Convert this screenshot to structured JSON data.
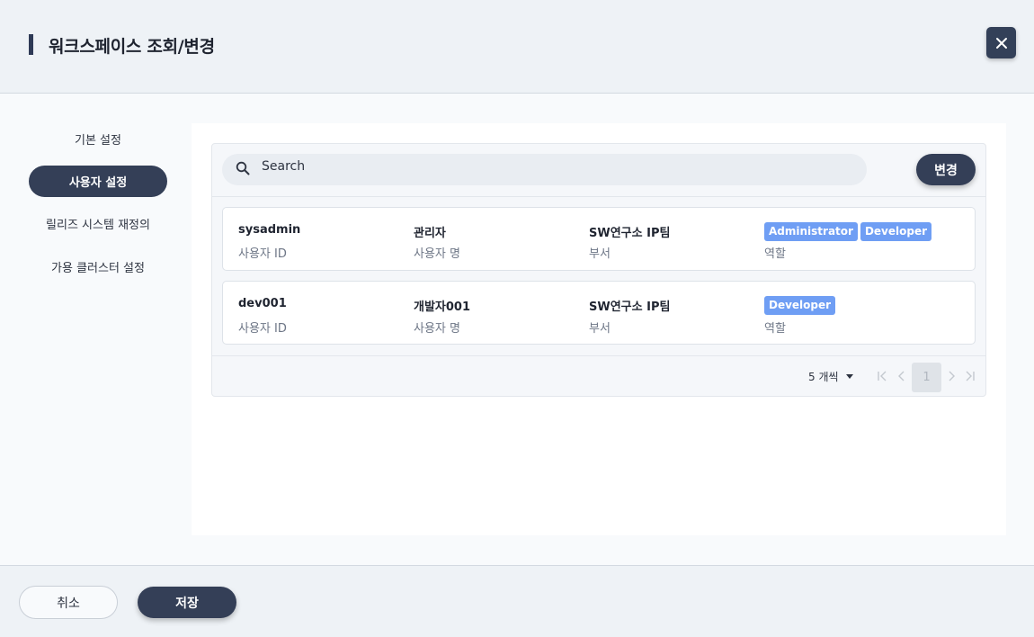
{
  "header": {
    "title": "워크스페이스 조회/변경",
    "close_icon": "close-icon"
  },
  "sidebar": {
    "items": [
      {
        "label": "기본 설정",
        "active": false
      },
      {
        "label": "사용자 설정",
        "active": true
      },
      {
        "label": "릴리즈 시스템 재정의",
        "active": false
      },
      {
        "label": "가용 클러스터 설정",
        "active": false
      }
    ]
  },
  "toolbar": {
    "search_placeholder": "Search",
    "search_icon": "search-icon",
    "change_label": "변경"
  },
  "columns": {
    "user_id": "사용자 ID",
    "user_name": "사용자 명",
    "department": "부서",
    "role": "역할"
  },
  "users": [
    {
      "user_id": "sysadmin",
      "user_name": "관리자",
      "department": "SW연구소 IP팀",
      "roles": [
        "Administrator",
        "Developer"
      ]
    },
    {
      "user_id": "dev001",
      "user_name": "개발자001",
      "department": "SW연구소 IP팀",
      "roles": [
        "Developer"
      ]
    }
  ],
  "pagination": {
    "page_size": "5 개씩",
    "current_page": "1"
  },
  "footer": {
    "cancel_label": "취소",
    "save_label": "저장"
  },
  "colors": {
    "primary": "#343f57",
    "badge": "#6f9ef4",
    "header_bg": "#eef2f6"
  }
}
